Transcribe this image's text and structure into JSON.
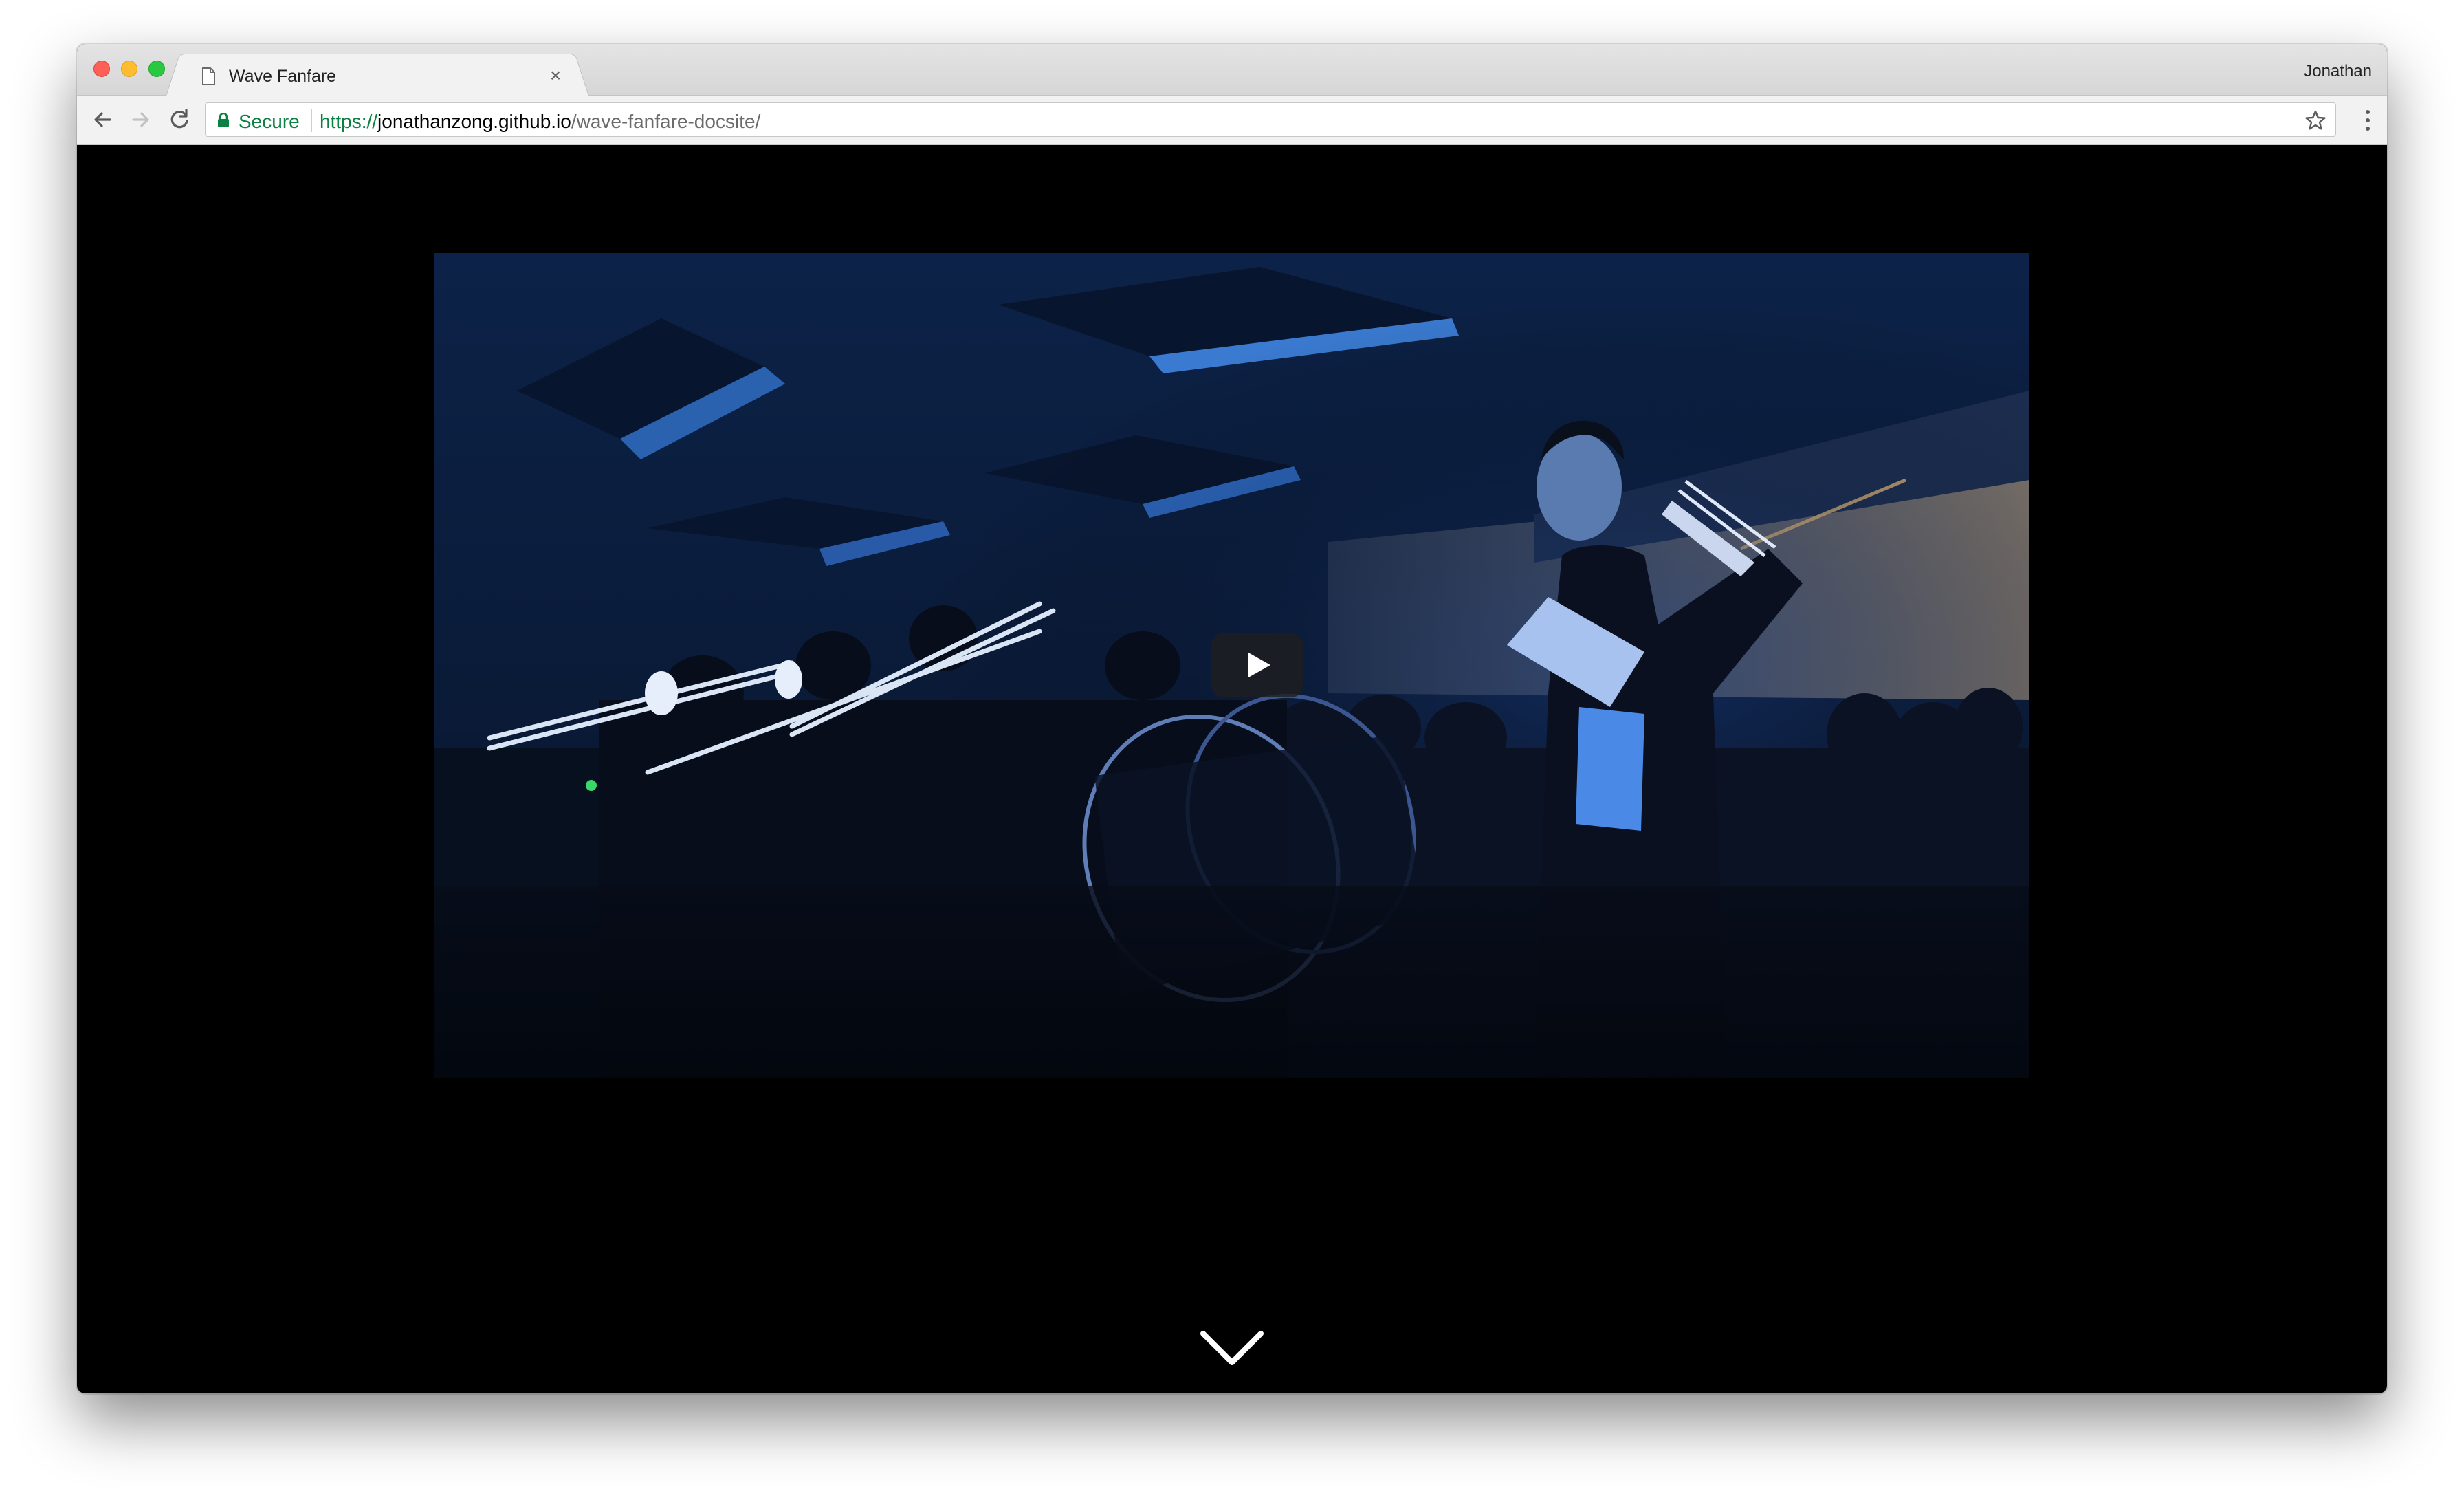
{
  "browser": {
    "tab": {
      "title": "Wave Fanfare",
      "close_glyph": "×",
      "favicon_icon": "page-icon"
    },
    "profile_name": "Jonathan",
    "toolbar": {
      "back_icon": "back-arrow-icon",
      "forward_icon": "forward-arrow-icon",
      "reload_icon": "reload-icon",
      "bookmark_icon": "star-icon",
      "menu_icon": "vertical-dots-icon"
    },
    "address_bar": {
      "security_label": "Secure",
      "url_scheme": "https://",
      "url_host": "jonathanzong.github.io",
      "url_path": "/wave-fanfare-docsite/"
    }
  },
  "page": {
    "background": "#000000",
    "video": {
      "state": "paused",
      "play_icon": "play-icon"
    },
    "scroll_indicator_icon": "chevron-down-icon"
  },
  "colors": {
    "secure_green": "#0b8043",
    "traffic_close": "#fe5f57",
    "traffic_minimize": "#febc2e",
    "traffic_maximize": "#28c840"
  }
}
